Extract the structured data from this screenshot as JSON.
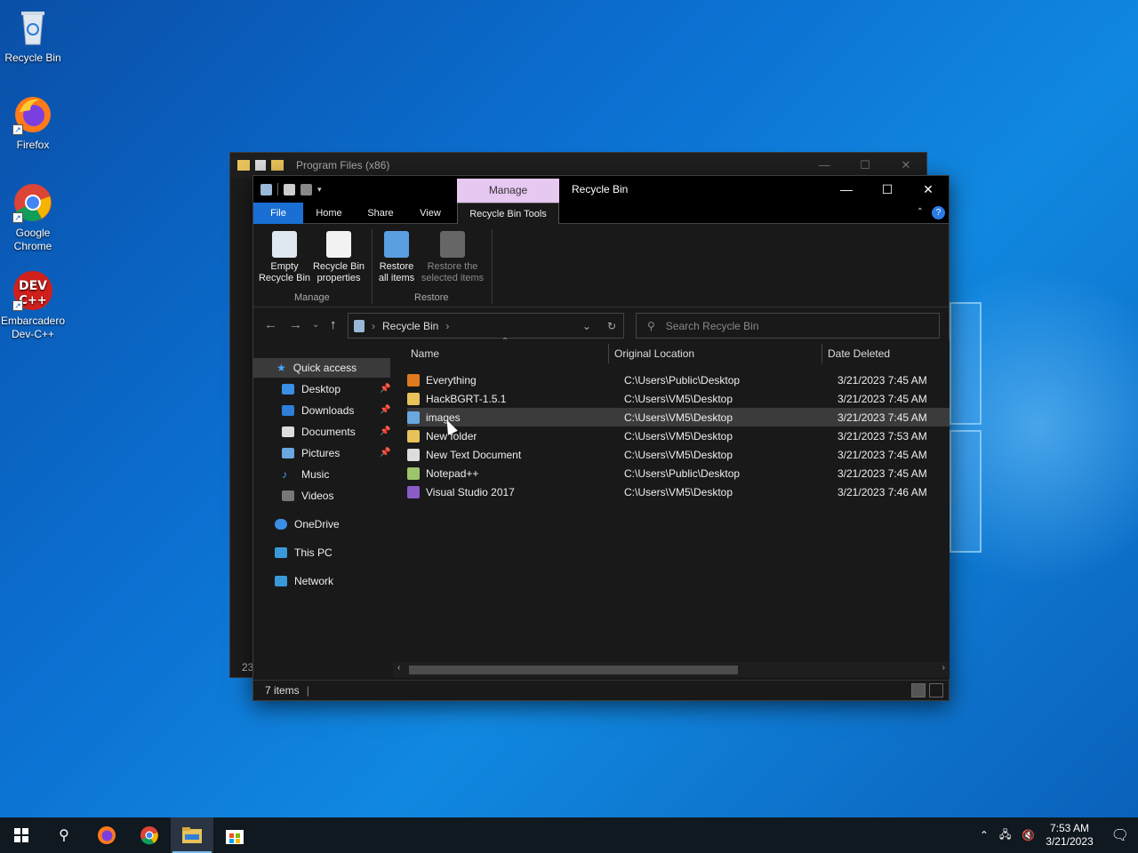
{
  "desktop": {
    "icons": [
      {
        "label": "Recycle Bin"
      },
      {
        "label": "Firefox"
      },
      {
        "label": "Google Chrome"
      },
      {
        "label": "Embarcadero Dev-C++"
      }
    ]
  },
  "back_window": {
    "title": "Program Files (x86)",
    "status_count": "23"
  },
  "window": {
    "title": "Recycle Bin",
    "manage_tab": "Manage",
    "controls": {
      "minimize": "—",
      "maximize": "☐",
      "close": "✕"
    },
    "tabs": [
      "File",
      "Home",
      "Share",
      "View",
      "Recycle Bin Tools"
    ],
    "help": "?",
    "ribbon": {
      "buttons": [
        {
          "label1": "Empty",
          "label2": "Recycle Bin"
        },
        {
          "label1": "Recycle Bin",
          "label2": "properties"
        },
        {
          "label1": "Restore",
          "label2": "all items"
        },
        {
          "label1": "Restore the",
          "label2": "selected items"
        }
      ],
      "groups": [
        "Manage",
        "Restore"
      ]
    },
    "address": {
      "path": "Recycle Bin",
      "search_placeholder": "Search Recycle Bin"
    },
    "nav": {
      "quick_access": "Quick access",
      "pinned": [
        "Desktop",
        "Downloads",
        "Documents",
        "Pictures"
      ],
      "others": [
        "Music",
        "Videos"
      ],
      "onedrive": "OneDrive",
      "this_pc": "This PC",
      "network": "Network"
    },
    "columns": [
      "Name",
      "Original Location",
      "Date Deleted"
    ],
    "rows": [
      {
        "name": "Everything",
        "location": "C:\\Users\\Public\\Desktop",
        "date": "3/21/2023 7:45 AM",
        "icon": "everything-icon",
        "color": "#e07a1f"
      },
      {
        "name": "HackBGRT-1.5.1",
        "location": "C:\\Users\\VM5\\Desktop",
        "date": "3/21/2023 7:45 AM",
        "icon": "folder-icon",
        "color": "#e8c25a"
      },
      {
        "name": "images",
        "location": "C:\\Users\\VM5\\Desktop",
        "date": "3/21/2023 7:45 AM",
        "icon": "image-file-icon",
        "color": "#6aa6e0"
      },
      {
        "name": "New folder",
        "location": "C:\\Users\\VM5\\Desktop",
        "date": "3/21/2023 7:53 AM",
        "icon": "folder-icon",
        "color": "#e8c25a"
      },
      {
        "name": "New Text Document",
        "location": "C:\\Users\\VM5\\Desktop",
        "date": "3/21/2023 7:45 AM",
        "icon": "text-file-icon",
        "color": "#dddddd"
      },
      {
        "name": "Notepad++",
        "location": "C:\\Users\\Public\\Desktop",
        "date": "3/21/2023 7:45 AM",
        "icon": "notepadpp-icon",
        "color": "#9cc46a"
      },
      {
        "name": "Visual Studio 2017",
        "location": "C:\\Users\\VM5\\Desktop",
        "date": "3/21/2023 7:46 AM",
        "icon": "visual-studio-icon",
        "color": "#8a5cc8"
      }
    ],
    "status": "7 items"
  },
  "taskbar": {
    "time": "7:53 AM",
    "date": "3/21/2023"
  }
}
